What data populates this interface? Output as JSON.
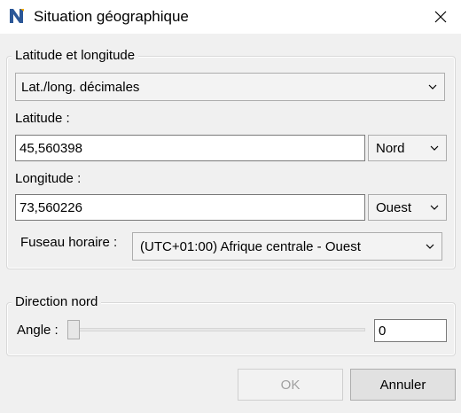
{
  "window": {
    "title": "Situation géographique",
    "icon": "app-n-icon"
  },
  "latlong_group": {
    "title": "Latitude et longitude",
    "format_select": "Lat./long. décimales",
    "latitude_label": "Latitude :",
    "latitude_value": "45,560398",
    "latitude_dir": "Nord",
    "longitude_label": "Longitude :",
    "longitude_value": "73,560226",
    "longitude_dir": "Ouest",
    "timezone_label": "Fuseau horaire :",
    "timezone_value": "(UTC+01:00) Afrique centrale - Ouest"
  },
  "north_group": {
    "title": "Direction nord",
    "angle_label": "Angle :",
    "angle_value": "0",
    "slider_level": 0
  },
  "buttons": {
    "ok": "OK",
    "cancel": "Annuler"
  },
  "colors": {
    "app_icon": "#2b5797",
    "ok_disabled_text": "#a0a0a0"
  }
}
